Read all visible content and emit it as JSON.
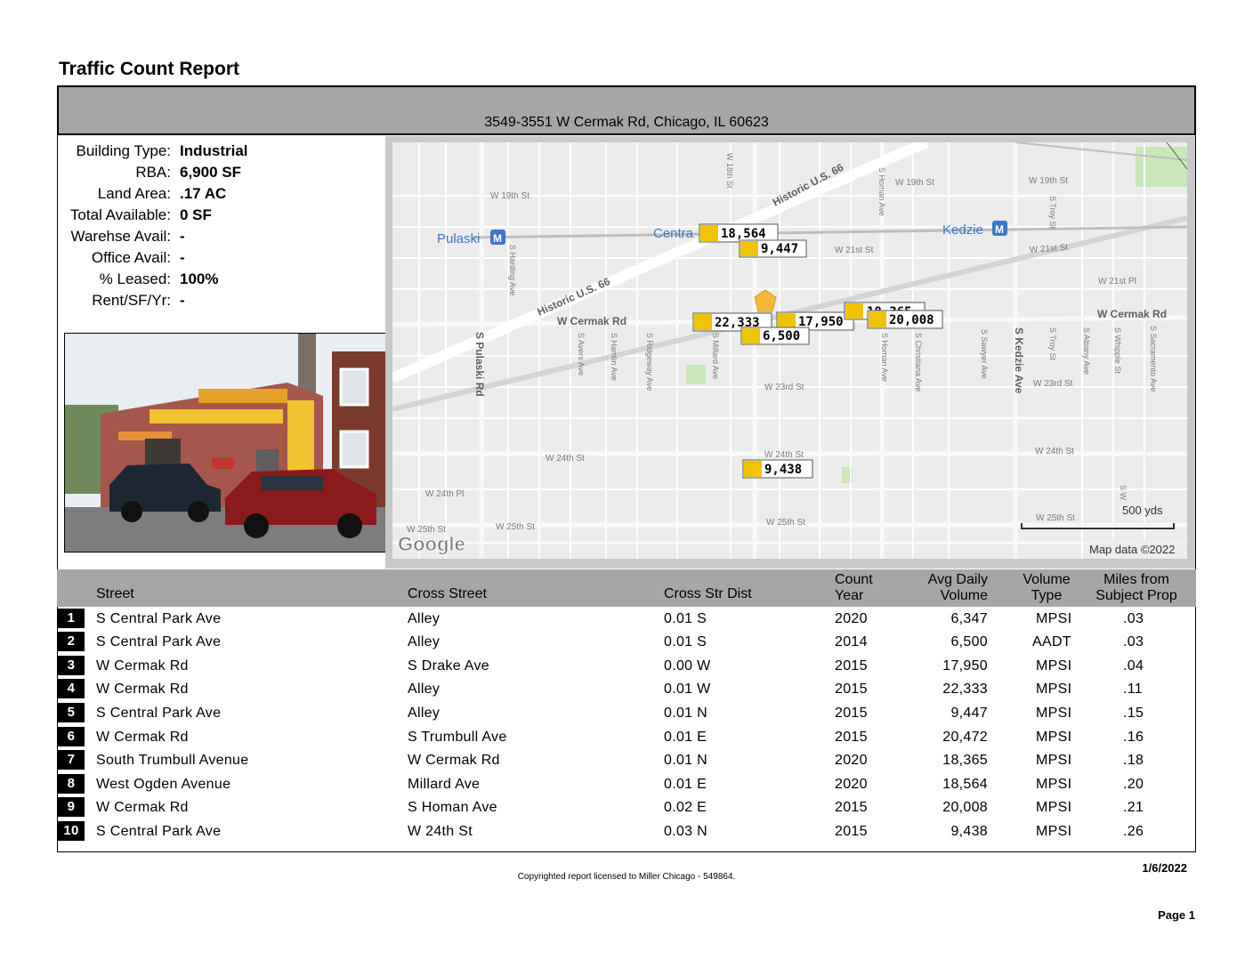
{
  "report": {
    "title": "Traffic Count Report",
    "address": "3549-3551 W Cermak Rd, Chicago, IL 60623"
  },
  "properties": [
    {
      "label": "Building Type:",
      "value": "Industrial"
    },
    {
      "label": "RBA:",
      "value": "6,900 SF"
    },
    {
      "label": "Land Area:",
      "value": ".17 AC"
    },
    {
      "label": "Total Available:",
      "value": "0 SF"
    },
    {
      "label": "Warehse Avail:",
      "value": "-"
    },
    {
      "label": "Office Avail:",
      "value": "-"
    },
    {
      "label": "% Leased:",
      "value": "100%"
    },
    {
      "label": "Rent/SF/Yr:",
      "value": "-"
    }
  ],
  "map": {
    "streets": {
      "w19th_a": "W 19th St",
      "w19th_b": "W 19th St",
      "w19th_c": "W 19th St",
      "w18th": "W 18th St",
      "w21st_a": "W 21st St",
      "w21st_b": "W 21st St",
      "w21st_pl": "W 21st Pl",
      "cermak_a": "W Cermak Rd",
      "cermak_b": "W Cermak Rd",
      "w23rd_a": "W 23rd St",
      "w23rd_b": "W 23rd St",
      "w24th_a": "W 24th St",
      "w24th_b": "W 24th St",
      "w24th_c": "W 24th St",
      "w24th_pl": "W 24th Pl",
      "w25th_a": "W 25th St",
      "w25th_b": "W 25th St",
      "w25th_c": "W 25th St",
      "w25th_d": "W 25th St",
      "hist66_a": "Historic U.S. 66",
      "hist66_b": "Historic U.S. 66",
      "pulaski_rd": "S Pulaski Rd",
      "harding": "S Harding Ave",
      "avers": "S Avers Ave",
      "hamlin": "S Hamlin Ave",
      "ridgeway": "S Ridgeway Ave",
      "millard": "S Millard Ave",
      "homan_a": "S Homan Ave",
      "homan_b": "S Homan Ave",
      "christiana": "S Christiana Ave",
      "sawyer": "S Sawyer Ave",
      "kedzie_ave": "S Kedzie Ave",
      "troy_a": "S Troy St",
      "troy_b": "S Troy St",
      "albany": "S Albany Ave",
      "whipple": "S Whipple St",
      "sacramento": "S Sacramento Ave",
      "w_small": "S W"
    },
    "stations": {
      "pulaski": "Pulaski",
      "central": "Centra",
      "kedzie": "Kedzie"
    },
    "station_icon": "M",
    "counts": {
      "c18564": "18,564",
      "c9447": "9,447",
      "c22333": "22,333",
      "c17950": "17,950",
      "c6500": "6,500",
      "c18365": "18,365",
      "c20008": "20,008",
      "c9438": "9,438"
    },
    "scale": "500 yds",
    "logo": "Google",
    "attribution": "Map data ©2022"
  },
  "table": {
    "headers": {
      "street": "Street",
      "cross_street": "Cross Street",
      "cross_dist": "Cross Str Dist",
      "count_year_1": "Count",
      "count_year_2": "Year",
      "avg_daily_1": "Avg Daily",
      "avg_daily_2": "Volume",
      "volume_type_1": "Volume",
      "volume_type_2": "Type",
      "miles_1": "Miles from",
      "miles_2": "Subject Prop"
    },
    "rows": [
      {
        "num": "1",
        "street": "S Central Park Ave",
        "cross": "Alley",
        "dist": "0.01 S",
        "year": "2020",
        "volume": "6,347",
        "type": "MPSI",
        "miles": ".03"
      },
      {
        "num": "2",
        "street": "S Central Park Ave",
        "cross": "Alley",
        "dist": "0.01 S",
        "year": "2014",
        "volume": "6,500",
        "type": "AADT",
        "miles": ".03"
      },
      {
        "num": "3",
        "street": "W Cermak Rd",
        "cross": "S Drake Ave",
        "dist": "0.00 W",
        "year": "2015",
        "volume": "17,950",
        "type": "MPSI",
        "miles": ".04"
      },
      {
        "num": "4",
        "street": "W Cermak Rd",
        "cross": "Alley",
        "dist": "0.01 W",
        "year": "2015",
        "volume": "22,333",
        "type": "MPSI",
        "miles": ".11"
      },
      {
        "num": "5",
        "street": "S Central Park Ave",
        "cross": "Alley",
        "dist": "0.01 N",
        "year": "2015",
        "volume": "9,447",
        "type": "MPSI",
        "miles": ".15"
      },
      {
        "num": "6",
        "street": "W Cermak Rd",
        "cross": "S Trumbull Ave",
        "dist": "0.01 E",
        "year": "2015",
        "volume": "20,472",
        "type": "MPSI",
        "miles": ".16"
      },
      {
        "num": "7",
        "street": "South Trumbull Avenue",
        "cross": "W Cermak Rd",
        "dist": "0.01 N",
        "year": "2020",
        "volume": "18,365",
        "type": "MPSI",
        "miles": ".18"
      },
      {
        "num": "8",
        "street": "West Ogden Avenue",
        "cross": "Millard Ave",
        "dist": "0.01 E",
        "year": "2020",
        "volume": "18,564",
        "type": "MPSI",
        "miles": ".20"
      },
      {
        "num": "9",
        "street": "W Cermak Rd",
        "cross": "S Homan Ave",
        "dist": "0.02 E",
        "year": "2015",
        "volume": "20,008",
        "type": "MPSI",
        "miles": ".21"
      },
      {
        "num": "10",
        "street": "S Central Park Ave",
        "cross": "W 24th St",
        "dist": "0.03 N",
        "year": "2015",
        "volume": "9,438",
        "type": "MPSI",
        "miles": ".26"
      }
    ]
  },
  "footer": {
    "date": "1/6/2022",
    "copyright": "Copyrighted report licensed to Miller Chicago - 549864.",
    "page": "Page 1"
  }
}
